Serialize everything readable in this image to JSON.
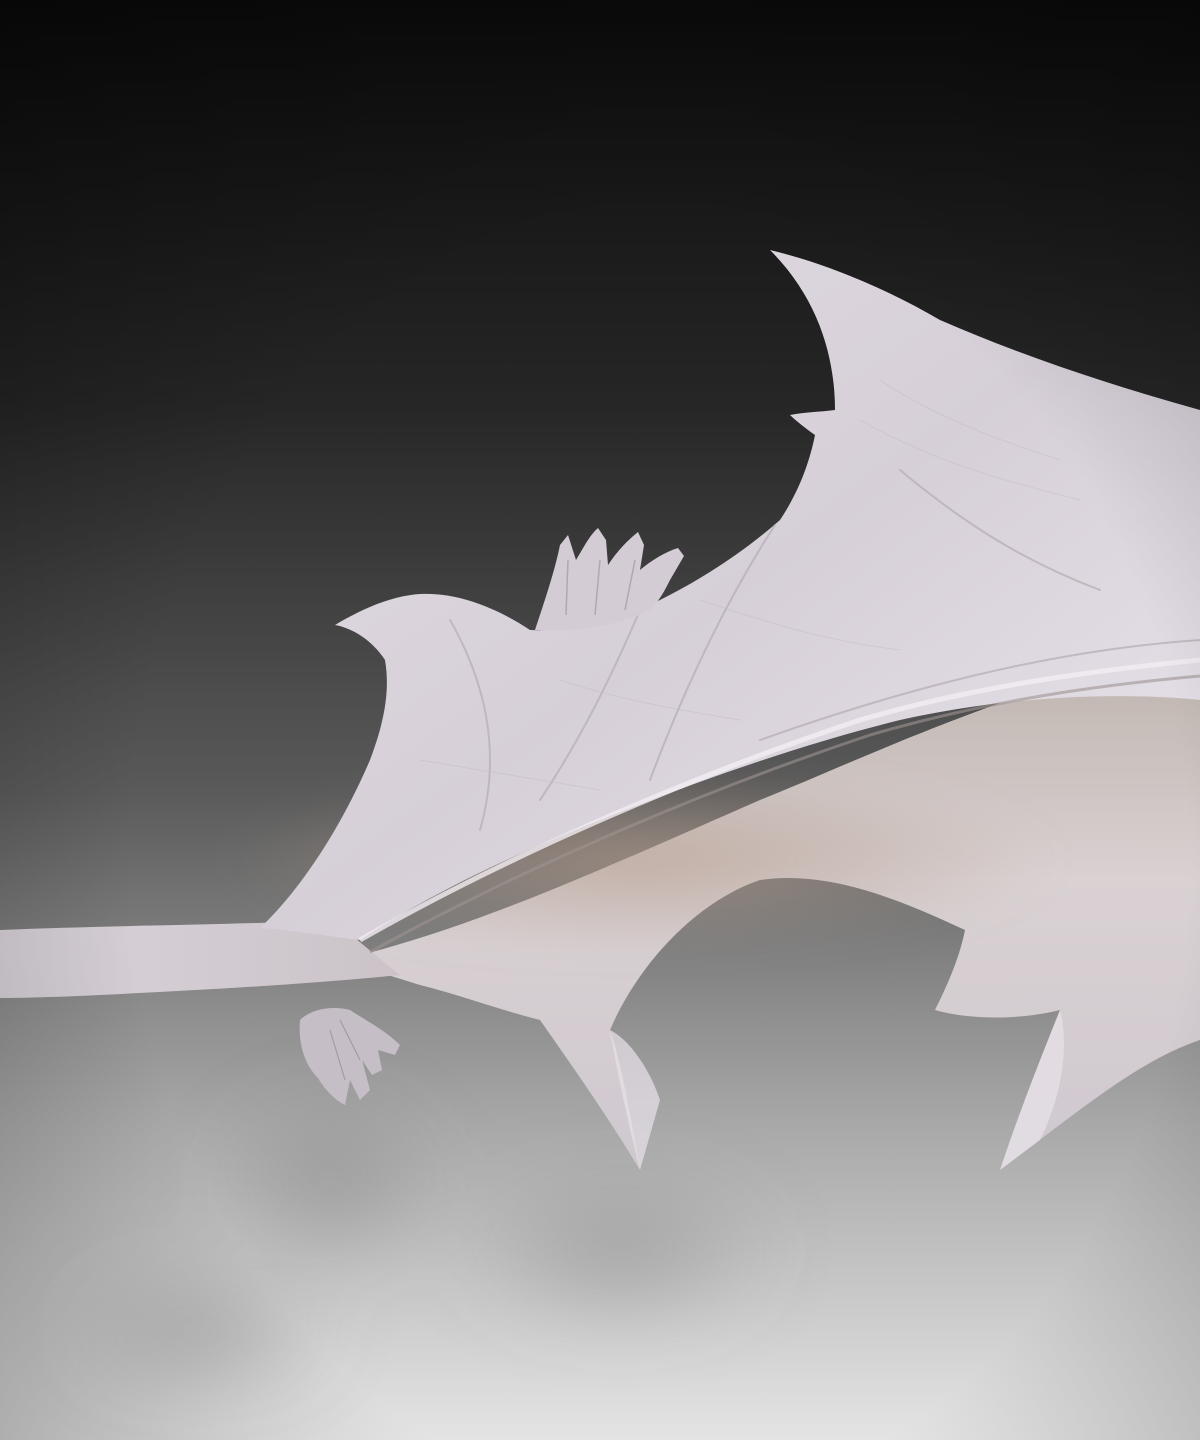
{
  "image": {
    "subject": "sculpted-winged-creature-render",
    "palette": {
      "background_top": "#0e0e0e",
      "background_mid": "#4a4a4a",
      "background_bottom": "#d8d8d8",
      "skin_light": "#e9e3ea",
      "skin_mid": "#cbc4cc",
      "skin_shadow": "#a79f9b",
      "skin_warm": "#b8aaa0",
      "floor_shadow": "#9a9a9a"
    }
  }
}
